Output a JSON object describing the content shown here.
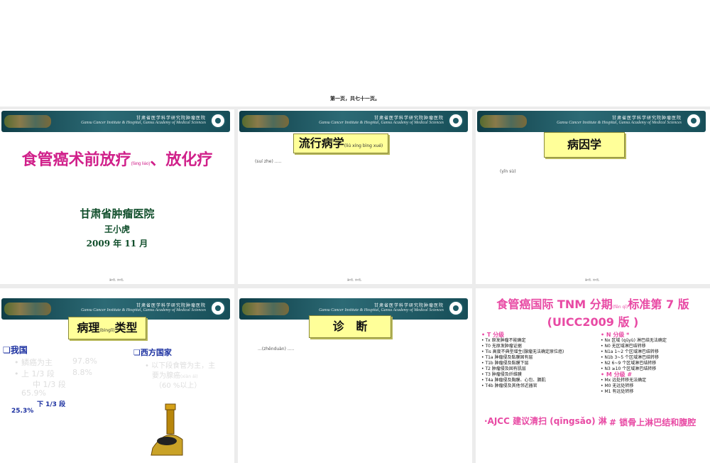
{
  "top": {
    "label": "第一页，共七十一页。"
  },
  "header": {
    "cn": "甘肃省医学科学研究院肿瘤医院",
    "en": "Gansu Cancer Institute & Hospital, Gansu Academy of Medical Sciences"
  },
  "footer": "第X页，共X页。",
  "slide1": {
    "title_a": "食管癌术前放疗",
    "ruby": "(fàng liáo)",
    "title_b": "、放化疗",
    "org": "甘肃省肿瘤医院",
    "author": "王小虎",
    "date": "2009 年 11 月"
  },
  "slide2": {
    "title": "流行病学",
    "ruby": "(liú xíng bìng xué)",
    "note": "(suí zhe) ....."
  },
  "slide3": {
    "title": "病因学",
    "note": "(yīn sù)"
  },
  "slide4": {
    "title": "病理",
    "ruby": "(bìnglǐ)",
    "title_b": "类型",
    "china_head": "我国",
    "china_l1": "鳞癌为主",
    "china_v1": "97.8%",
    "china_l2": "上 1/3 段",
    "china_v2": "8.8%",
    "china_l3": "中 1/3 段",
    "china_v3": "65.9%",
    "china_l4": "下 1/3 段",
    "china_v4": "25.3%",
    "west_head": "西方国家",
    "west_l1": "以下段食管为主，主",
    "west_l2": "要为腺癌",
    "west_ruby": "(xiàn ái)",
    "west_l3": "（60 %以上）"
  },
  "slide5": {
    "title": "诊   断",
    "note": "...(zhěnduàn) ....."
  },
  "slide6": {
    "title_a": "食管癌国际 TNM 分期",
    "ruby": "(fēn qī)",
    "title_b": "标准第 7 版",
    "title_c": "(UICC2009 版 )",
    "t_head": "T 分级",
    "t_items": [
      "Tx  原发肿瘤不能确定",
      "T0  无原发肿瘤证据",
      "Tis  高度不典型增生(腺瘤无法确定原位癌)",
      "T1a  肿瘤侵及黏膜固有层",
      "T1b  肿瘤侵及黏膜下层",
      "T2  肿瘤侵及固有肌层",
      "T3  肿瘤侵及纤维膜",
      "T4a  肿瘤侵及胸膜、心包、膈肌",
      "T4b  肿瘤侵及其他邻近器官"
    ],
    "n_head": "N 分级 *",
    "n_items": [
      "Nx  区域 (qūyù) 淋巴结无法确定",
      "N0  无区域淋巴结转移",
      "N1a 1~2 个区域淋巴结转移",
      "N1b 3~5 个区域淋巴结转移",
      "N2 6~9 个区域淋巴结转移",
      "N3 ≥10 个区域淋巴结转移"
    ],
    "m_head": "M 分级 #",
    "m_items": [
      "Mx  远处转移无法确定",
      "M0  无远处转移",
      "M1  有远处转移"
    ],
    "bottom_left": "·AJCC 建议清扫 (qīngsǎo) 淋",
    "bottom_right": "#  锁骨上淋巴结和腹腔"
  }
}
